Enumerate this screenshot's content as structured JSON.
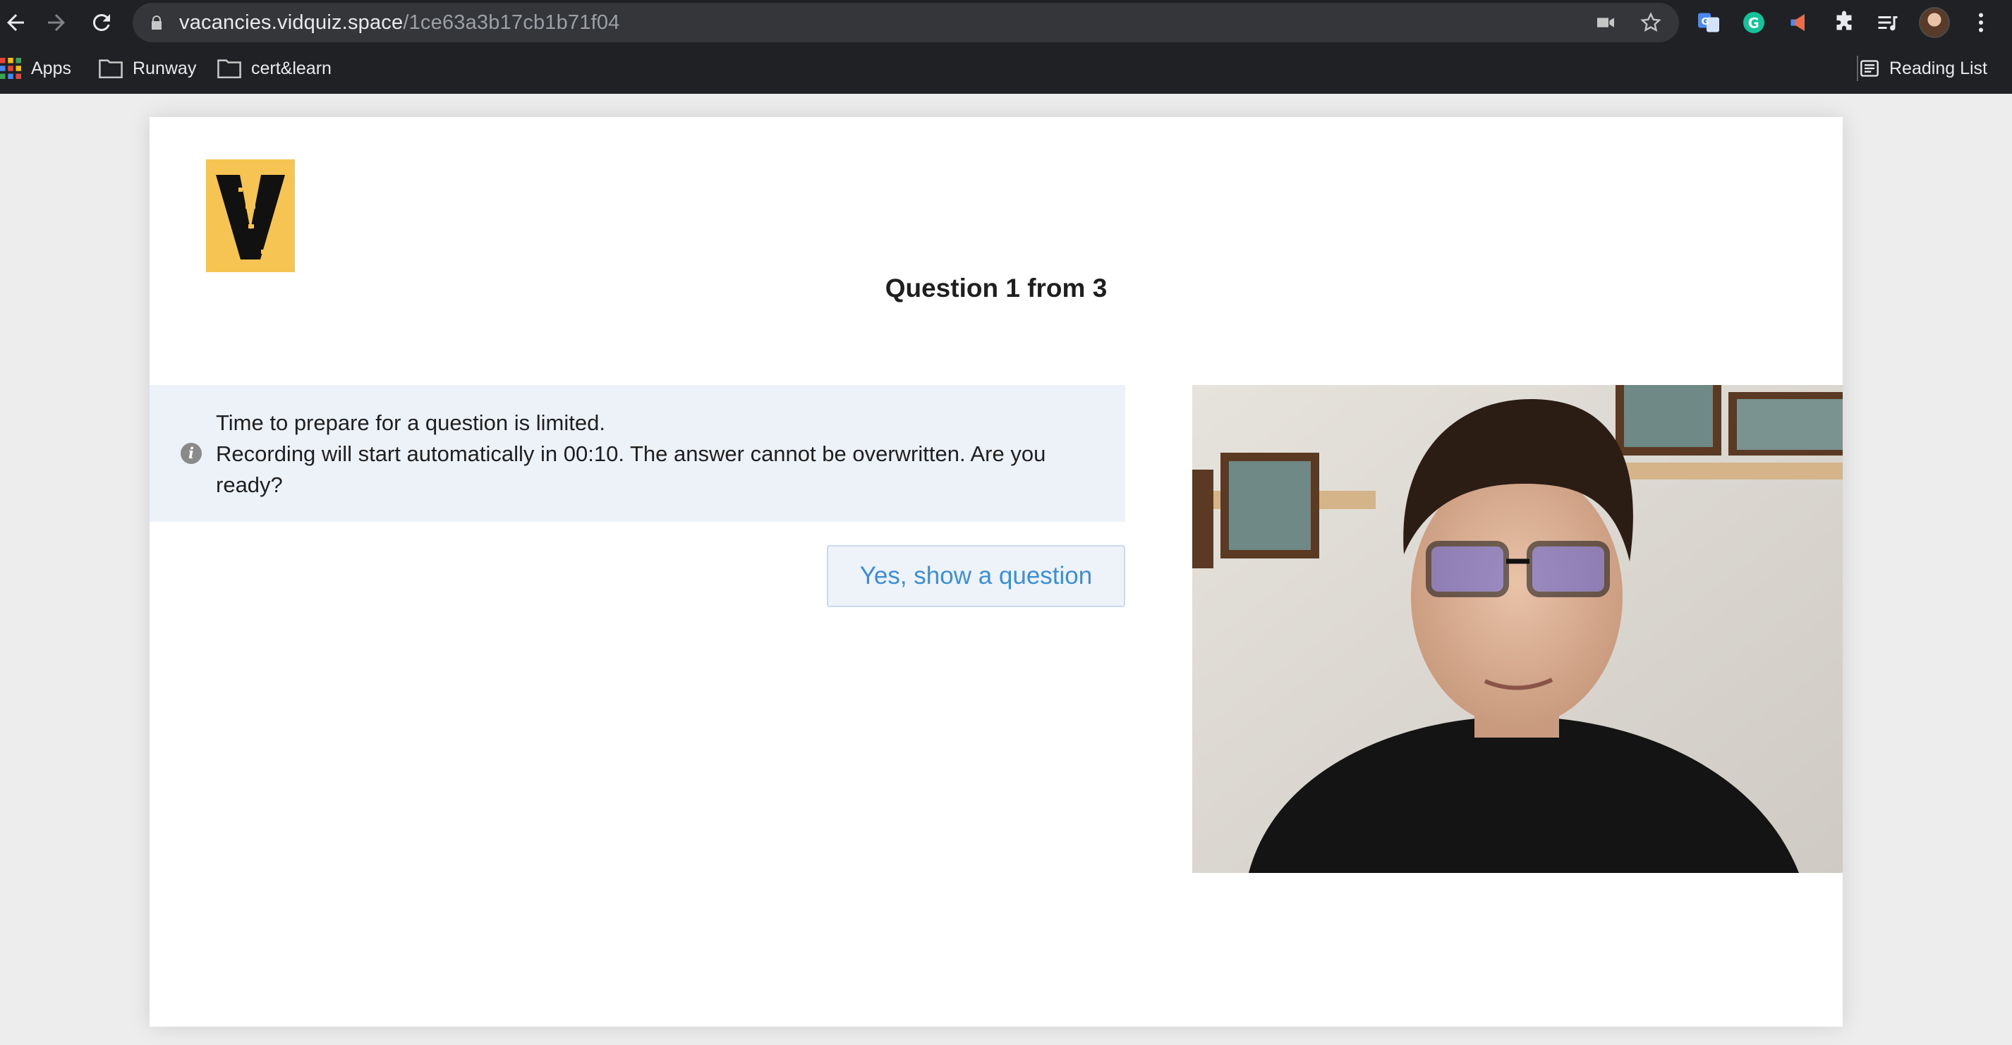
{
  "browser": {
    "url_host": "vacancies.vidquiz.space",
    "url_path": "/1ce63a3b17cb1b71f04",
    "bookmarks": [
      {
        "label": "Apps",
        "icon": "apps-grid-icon"
      },
      {
        "label": "Runway",
        "icon": "folder-icon"
      },
      {
        "label": "cert&learn",
        "icon": "folder-icon"
      }
    ],
    "reading_list_label": "Reading List"
  },
  "page": {
    "question_title": "Question 1 from 3",
    "notice_line1": "Time to prepare for a question is limited.",
    "notice_line2": "Recording will start automatically in 00:10. The answer cannot be overwritten. Are you ready?",
    "show_button_label": "Yes, show a question",
    "logo_letter": "V"
  },
  "colors": {
    "accent": "#3b8fd6",
    "notice_bg": "#edf2f9",
    "logo_bg": "#f6c453"
  }
}
